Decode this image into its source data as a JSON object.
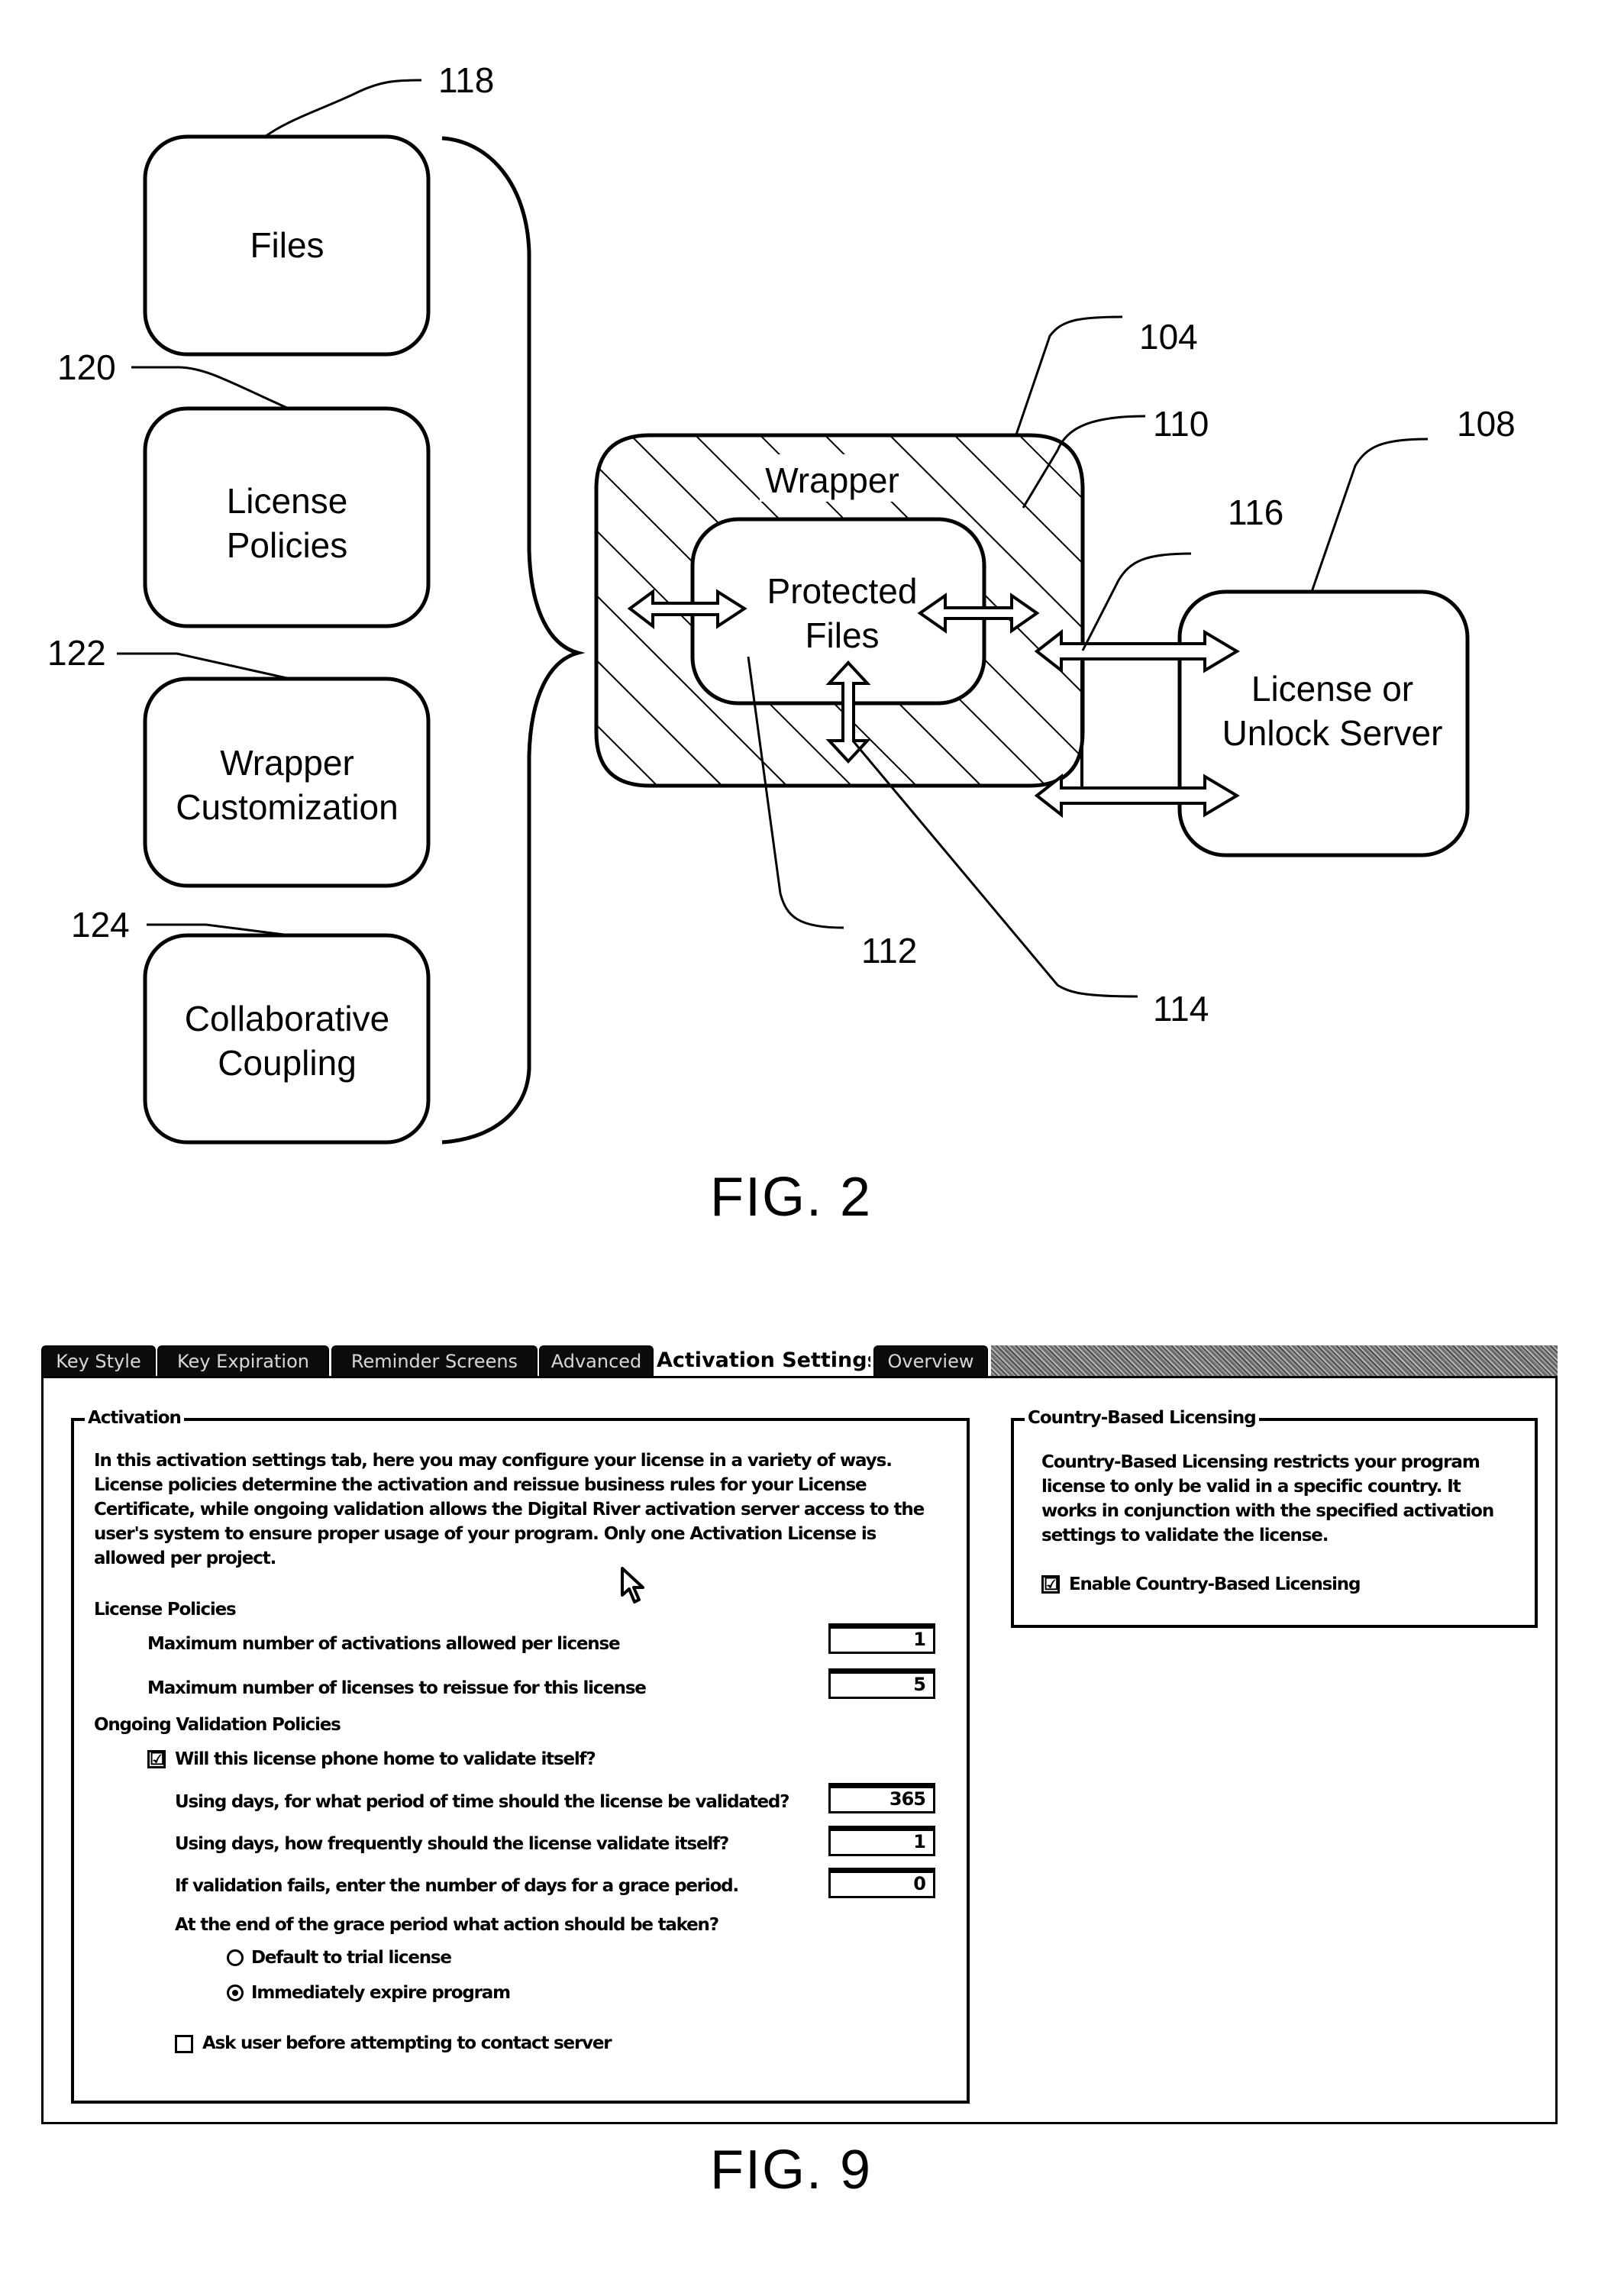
{
  "fig2": {
    "caption": "FIG. 2",
    "components": [
      {
        "ref": "118",
        "label_lines": [
          "Files"
        ]
      },
      {
        "ref": "120",
        "label_lines": [
          "License",
          "Policies"
        ]
      },
      {
        "ref": "122",
        "label_lines": [
          "Wrapper",
          "Customization"
        ]
      },
      {
        "ref": "124",
        "label_lines": [
          "Collaborative",
          "Coupling"
        ]
      }
    ],
    "wrapper": {
      "ref": "104",
      "label": "Wrapper",
      "hatch_ref": "110"
    },
    "protected_files": {
      "ref": "112",
      "label_lines": [
        "Protected",
        "Files"
      ]
    },
    "arrow_refs": {
      "inner_arrow": "114",
      "server_arrows": "116"
    },
    "server": {
      "ref": "108",
      "label_lines": [
        "License or",
        "Unlock Server"
      ]
    }
  },
  "fig9": {
    "caption": "FIG. 9",
    "tabs": [
      {
        "label": "Key Style",
        "active": false
      },
      {
        "label": "Key Expiration",
        "active": false
      },
      {
        "label": "Reminder Screens",
        "active": false
      },
      {
        "label": "Advanced",
        "active": false
      },
      {
        "label": "Activation Settings",
        "active": true
      },
      {
        "label": "Overview",
        "active": false
      }
    ],
    "activation": {
      "title": "Activation",
      "description_lines": [
        "In this activation settings tab, here you may configure your license in a variety of ways.",
        "License policies determine the activation and reissue business rules for your License",
        "Certificate, while ongoing validation allows the Digital River activation server access to the",
        "user's system to ensure proper usage of your program.  Only one Activation License is",
        "allowed per project."
      ],
      "license_policies": {
        "heading": "License Policies",
        "max_activations_label": "Maximum number of activations allowed per license",
        "max_activations_value": "1",
        "max_reissues_label": "Maximum number of licenses to reissue for this license",
        "max_reissues_value": "5"
      },
      "ongoing_validation": {
        "heading": "Ongoing Validation Policies",
        "phone_home_label": "Will this license phone home to validate itself?",
        "phone_home_checked": true,
        "period_label": "Using days, for what period of time should the license be validated?",
        "period_value": "365",
        "frequency_label": "Using days, how frequently should the license validate itself?",
        "frequency_value": "1",
        "grace_label": "If validation fails, enter the number of days for a grace period.",
        "grace_value": "0",
        "end_action_question": "At the end of the grace period what action should be taken?",
        "end_action_options": [
          {
            "label": "Default to trial license",
            "selected": false
          },
          {
            "label": "Immediately expire program",
            "selected": true
          }
        ],
        "ask_user_label": "Ask user before attempting to contact server",
        "ask_user_checked": false
      }
    },
    "country": {
      "title": "Country-Based Licensing",
      "description_lines": [
        "Country-Based Licensing restricts your program",
        "license to only be valid in a specific country.  It",
        "works in conjunction with the specified activation",
        "settings to validate the license."
      ],
      "enable_label": "Enable Country-Based Licensing",
      "enable_checked": true
    },
    "check_glyph": "☑"
  }
}
